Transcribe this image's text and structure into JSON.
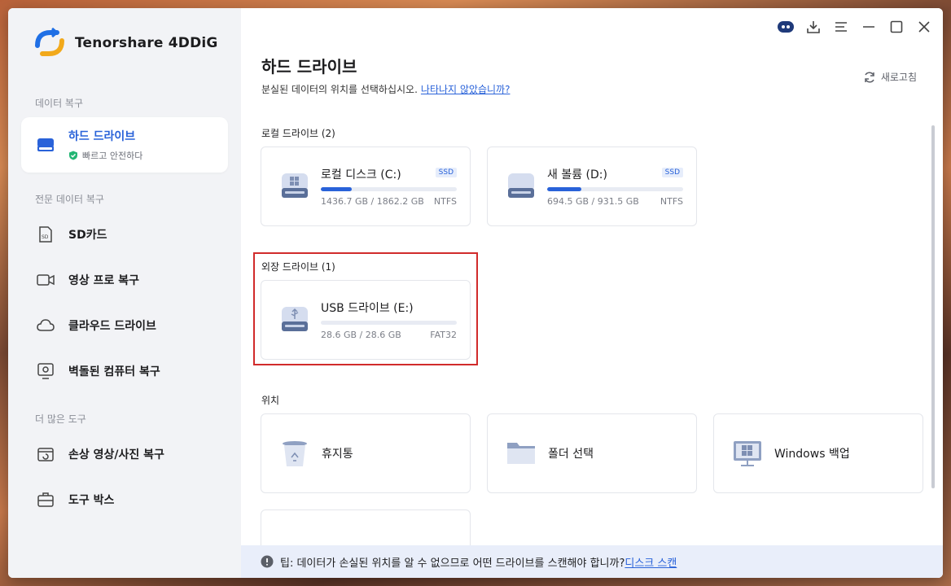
{
  "app": {
    "name": "Tenorshare 4DDiG"
  },
  "sidebar": {
    "section_recover": "데이터 복구",
    "active_item": {
      "title": "하드 드라이브",
      "subtitle": "빠르고 안전하다"
    },
    "section_pro": "전문 데이터 복구",
    "pro_items": [
      {
        "label": "SD카드",
        "icon": "sd-card-icon"
      },
      {
        "label": "영상 프로 복구",
        "icon": "video-icon"
      },
      {
        "label": "클라우드 드라이브",
        "icon": "cloud-icon"
      },
      {
        "label": "벽돌된 컴퓨터 복구",
        "icon": "computer-repair-icon"
      }
    ],
    "section_tools": "더 많은 도구",
    "tool_items": [
      {
        "label": "손상 영상/사진 복구",
        "icon": "media-repair-icon"
      },
      {
        "label": "도구 박스",
        "icon": "toolbox-icon"
      }
    ]
  },
  "main": {
    "title": "하드 드라이브",
    "description": "분실된 데이터의 위치를 선택하십시오.",
    "not_found_link": "나타나지 않았습니까?",
    "refresh": "새로고침",
    "local_label": "로컬 드라이브 (2)",
    "local_drives": [
      {
        "name": "로컬 디스크 (C:)",
        "tag": "SSD",
        "size": "1436.7 GB / 1862.2 GB",
        "fs": "NTFS",
        "used_fraction": 0.23
      },
      {
        "name": "새 볼륨 (D:)",
        "tag": "SSD",
        "size": "694.5 GB / 931.5 GB",
        "fs": "NTFS",
        "used_fraction": 0.25
      }
    ],
    "external_label": "외장 드라이브 (1)",
    "external_drives": [
      {
        "name": "USB 드라이브 (E:)",
        "size": "28.6 GB / 28.6 GB",
        "fs": "FAT32",
        "used_fraction": 0.0
      }
    ],
    "location_label": "위치",
    "locations": [
      {
        "label": "휴지통",
        "icon": "recycle-bin-icon"
      },
      {
        "label": "폴더 선택",
        "icon": "folder-icon"
      },
      {
        "label": "Windows 백업",
        "icon": "windows-backup-icon"
      }
    ]
  },
  "tip": {
    "text": "팁: 데이터가 손실된 위치를 알 수 없으므로 어떤 드라이브를 스캔해야 합니까?",
    "link": "디스크 스캔"
  },
  "colors": {
    "accent": "#2962d9",
    "highlight": "#d12b2b"
  }
}
